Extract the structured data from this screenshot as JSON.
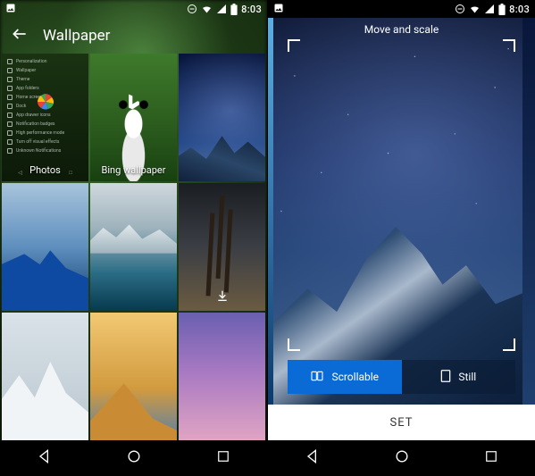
{
  "status": {
    "time": "8:03"
  },
  "left": {
    "title": "Wallpaper",
    "tiles": {
      "photos": "Photos",
      "bing": "Bing wallpaper"
    }
  },
  "right": {
    "move_scale": "Move and scale",
    "scrollable": "Scrollable",
    "still": "Still",
    "set": "SET"
  }
}
